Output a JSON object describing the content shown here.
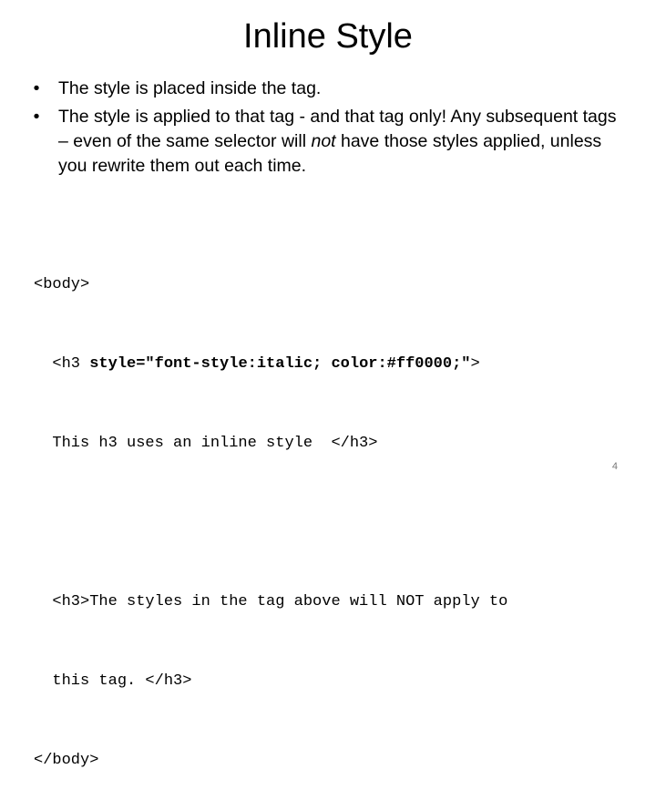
{
  "slide": {
    "title": "Inline Style",
    "bullets": [
      {
        "text_parts": [
          "The style is placed inside the tag."
        ]
      },
      {
        "before": "The style is applied to that tag - and that tag only! Any subsequent tags – even of the same selector will ",
        "italic": "not",
        "after": " have those styles applied, unless you rewrite them out each time."
      }
    ],
    "bullet_glyph": "•",
    "code": {
      "line1": "<body>",
      "line2_indent": "  ",
      "line2_tag": "<h3 ",
      "line2_bold": "style=\"font-style:italic; color:#ff0000;\"",
      "line2_end": ">",
      "line3": "  This h3 uses an inline style  </h3>",
      "line5": "  <h3>The styles in the tag above will NOT apply to",
      "line6": "  this tag. </h3>",
      "line7": "</body>"
    },
    "page_number": "4"
  }
}
